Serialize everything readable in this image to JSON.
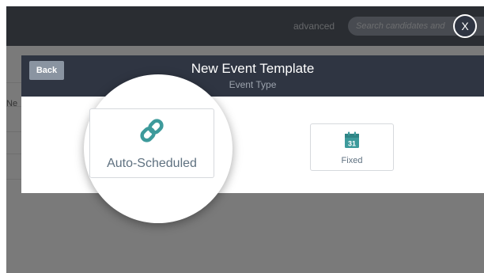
{
  "app": {
    "advanced_label": "advanced",
    "search_placeholder": "Search candidates and",
    "partial_cell_text": "Ne"
  },
  "modal": {
    "back_label": "Back",
    "title": "New Event Template",
    "subtitle": "Event Type",
    "close_label": "X",
    "options": [
      {
        "label": "Auto-Scheduled",
        "icon": "link-icon"
      },
      {
        "label": "Fixed",
        "icon": "calendar-icon",
        "calendar_day": "31"
      }
    ]
  },
  "colors": {
    "header_bg": "#2f3542",
    "accent_teal": "#3d9a9b",
    "back_button_bg": "#8a94a1",
    "card_label": "#5f7180"
  }
}
